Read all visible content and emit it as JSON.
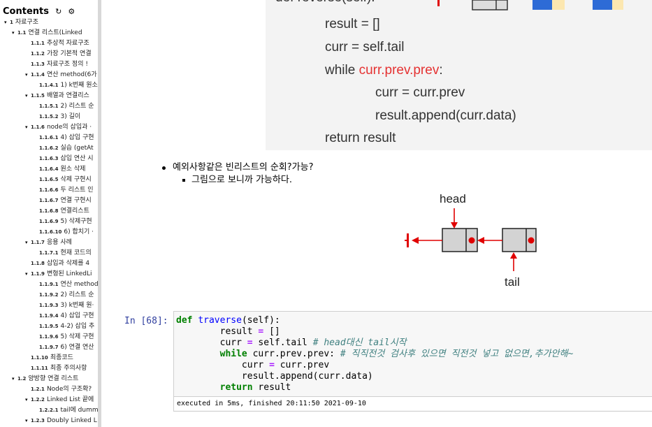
{
  "toc": {
    "title": "Contents",
    "refresh_icon": "refresh-icon",
    "settings_icon": "gear-icon",
    "items": [
      {
        "num": "1",
        "label": "자료구조",
        "caret": true,
        "level": 0
      },
      {
        "num": "1.1",
        "label": "연결 리스트(Linked",
        "caret": true,
        "level": 1
      },
      {
        "num": "1.1.1",
        "label": "추상적 자료구조",
        "caret": false,
        "level": 2
      },
      {
        "num": "1.1.2",
        "label": "가장 기본적 연결",
        "caret": false,
        "level": 2
      },
      {
        "num": "1.1.3",
        "label": "자료구조 정의 !",
        "caret": false,
        "level": 2
      },
      {
        "num": "1.1.4",
        "label": "연산 method(6가",
        "caret": true,
        "level": 2
      },
      {
        "num": "1.1.4.1",
        "label": "1) k번째 원소",
        "caret": false,
        "level": 3
      },
      {
        "num": "1.1.5",
        "label": "배열과 연결리스",
        "caret": true,
        "level": 2
      },
      {
        "num": "1.1.5.1",
        "label": "2) 리스트 순",
        "caret": false,
        "level": 3
      },
      {
        "num": "1.1.5.2",
        "label": "3) 길이",
        "caret": false,
        "level": 3
      },
      {
        "num": "1.1.6",
        "label": "node의 삽입과 ·",
        "caret": true,
        "level": 2
      },
      {
        "num": "1.1.6.1",
        "label": "4) 삽입 구현",
        "caret": false,
        "level": 3
      },
      {
        "num": "1.1.6.2",
        "label": "실습 (getAt",
        "caret": false,
        "level": 3
      },
      {
        "num": "1.1.6.3",
        "label": "삽입 연산 시",
        "caret": false,
        "level": 3
      },
      {
        "num": "1.1.6.4",
        "label": "원소 삭제",
        "caret": false,
        "level": 3
      },
      {
        "num": "1.1.6.5",
        "label": "삭제 구현시",
        "caret": false,
        "level": 3
      },
      {
        "num": "1.1.6.6",
        "label": "두 리스트 인",
        "caret": false,
        "level": 3
      },
      {
        "num": "1.1.6.7",
        "label": "연결 구현시",
        "caret": false,
        "level": 3
      },
      {
        "num": "1.1.6.8",
        "label": "연결리스트",
        "caret": false,
        "level": 3
      },
      {
        "num": "1.1.6.9",
        "label": "5) 삭제구현",
        "caret": false,
        "level": 3
      },
      {
        "num": "1.1.6.10",
        "label": "6) 합치기 ·",
        "caret": false,
        "level": 3
      },
      {
        "num": "1.1.7",
        "label": "응용 사례",
        "caret": true,
        "level": 2
      },
      {
        "num": "1.1.7.1",
        "label": "현재 코드의",
        "caret": false,
        "level": 3
      },
      {
        "num": "1.1.8",
        "label": "삽입과 삭제를 4",
        "caret": false,
        "level": 2
      },
      {
        "num": "1.1.9",
        "label": "변형된 LinkedLi",
        "caret": true,
        "level": 2
      },
      {
        "num": "1.1.9.1",
        "label": "연산 method",
        "caret": false,
        "level": 3
      },
      {
        "num": "1.1.9.2",
        "label": "2) 리스트 순",
        "caret": false,
        "level": 3
      },
      {
        "num": "1.1.9.3",
        "label": "3) k번째 원·",
        "caret": false,
        "level": 3
      },
      {
        "num": "1.1.9.4",
        "label": "4) 삽입 구현",
        "caret": false,
        "level": 3
      },
      {
        "num": "1.1.9.5",
        "label": "4-2) 삽입 추",
        "caret": false,
        "level": 3
      },
      {
        "num": "1.1.9.6",
        "label": "5) 삭제 구현",
        "caret": false,
        "level": 3
      },
      {
        "num": "1.1.9.7",
        "label": "6) 연결 연산",
        "caret": false,
        "level": 3
      },
      {
        "num": "1.1.10",
        "label": "최종코드",
        "caret": false,
        "level": 2
      },
      {
        "num": "1.1.11",
        "label": "최종 주의사항",
        "caret": false,
        "level": 2
      },
      {
        "num": "1.2",
        "label": "양방향 연결 리스트",
        "caret": true,
        "level": 1
      },
      {
        "num": "1.2.1",
        "label": "Node의 구조확?",
        "caret": false,
        "level": 2
      },
      {
        "num": "1.2.2",
        "label": "Linked List 끝에",
        "caret": true,
        "level": 2
      },
      {
        "num": "1.2.2.1",
        "label": "tail에 dumm",
        "caret": false,
        "level": 3
      },
      {
        "num": "1.2.3",
        "label": "Doubly Linked L",
        "caret": true,
        "level": 2
      }
    ]
  },
  "slide": {
    "line0": "def reverse(self):",
    "line1": "result = []",
    "line2": "curr = self.tail",
    "line3_kw": "while ",
    "line3_red": "curr.prev.prev",
    "line3_end": ":",
    "line4": "curr = curr.prev",
    "line5": "result.append(curr.data)",
    "line6": "return result"
  },
  "markdown": {
    "bullet1": "예외사항같은 빈리스트의 순회?가능?",
    "bullet2": "그림으로 보니까 가능하다."
  },
  "diagram": {
    "head_label": "head",
    "tail_label": "tail"
  },
  "cell": {
    "prompt": "In [68]:",
    "code": {
      "l1_def": "def",
      "l1_name": "traverse",
      "l1_rest": "(self):",
      "l2_a": "result",
      "l2_op": "=",
      "l2_b": "[]",
      "l3_a": "curr",
      "l3_op": "=",
      "l3_b": "self.tail",
      "l3_comment": "# head대신 tail시작",
      "l4_kw": "while",
      "l4_rest": "curr.prev.prev:",
      "l4_comment": "# 직직전것 검사후 있으면 직전것 넣고 없으면,추가안해~",
      "l5_a": "curr",
      "l5_op": "=",
      "l5_b": "curr.prev",
      "l6": "result.append(curr.data)",
      "l7_kw": "return",
      "l7_rest": "result"
    },
    "exec_info": "executed in 5ms, finished 20:11:50 2021-09-10"
  }
}
